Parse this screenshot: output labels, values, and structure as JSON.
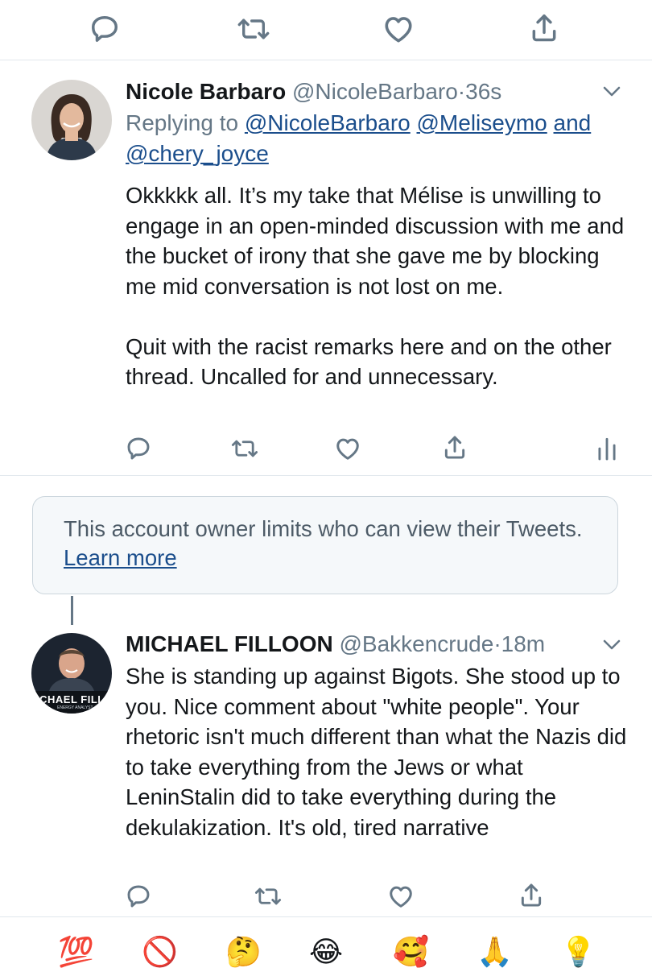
{
  "tweet1": {
    "name": "Nicole Barbaro",
    "handle": "@NicoleBarbaro",
    "sep": "·",
    "time": "36s",
    "replying_prefix": "Replying to",
    "reply_mention_1": "@NicoleBarbaro",
    "reply_mention_2": "@Meliseymo",
    "reply_and": "and",
    "reply_mention_3": "@chery_joyce",
    "text": "Okkkkk all. It’s my take that Mélise is unwilling to engage in an open-minded discussion with me and the bucket of irony that she gave me by blocking me mid conversation is not lost on me.\n\nQuit with the racist remarks here and on the other thread. Uncalled for and unnecessary."
  },
  "notice": {
    "text": "This account owner limits who can view their Tweets.",
    "link": "Learn more"
  },
  "tweet2": {
    "name": "MICHAEL FILLOON",
    "handle": "@Bakkencrude",
    "sep": "·",
    "time": "18m",
    "avatar_text": "ICHAEL FILLO",
    "avatar_subtext": "ENERGY ANALYST",
    "text": "She is standing up against Bigots. She stood up to you. Nice comment about \"white people\".  Your rhetoric isn't much different than what the Nazis did to take everything from the Jews or what LeninStalin did to take everything during the dekulakization. It's old, tired narrative"
  },
  "icons": {
    "reply": "reply-icon",
    "retweet": "retweet-icon",
    "like": "heart-icon",
    "share": "share-icon",
    "analytics": "analytics-icon",
    "menu": "chevron-down-icon"
  },
  "emoji_bar": {
    "items": [
      "💯",
      "🚫",
      "🤔",
      "😂",
      "🥰",
      "🙏",
      "💡"
    ]
  },
  "colors": {
    "text": "#14171a",
    "muted": "#657786",
    "link": "#1b4e8c",
    "divider": "#e1e8ed",
    "notice_bg": "#f5f8fa",
    "notice_border": "#ccd6dd"
  }
}
